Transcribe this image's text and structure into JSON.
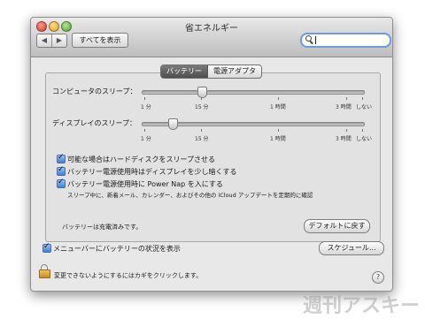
{
  "window": {
    "title": "省エネルギー"
  },
  "toolbar": {
    "back_label": "◀",
    "forward_label": "▶",
    "show_all_label": "すべてを表示",
    "search_placeholder": ""
  },
  "tabs": [
    {
      "label": "バッテリー",
      "active": true
    },
    {
      "label": "電源アダプタ",
      "active": false
    }
  ],
  "sliders": {
    "computer_sleep": {
      "label": "コンピュータのスリープ：",
      "value": "15 分",
      "ticks": [
        "1 分",
        "15 分",
        "1 時間",
        "3 時間",
        "しない"
      ]
    },
    "display_sleep": {
      "label": "ディスプレイのスリープ：",
      "value": "5 分",
      "ticks": [
        "1 分",
        "15 分",
        "1 時間",
        "3 時間",
        "しない"
      ]
    }
  },
  "checkboxes": [
    {
      "label": "可能な場合はハードディスクをスリープさせる",
      "checked": true
    },
    {
      "label": "バッテリー電源使用時はディスプレイを少し暗くする",
      "checked": true
    },
    {
      "label": "バッテリー電源使用時に Power Nap を入にする",
      "checked": true,
      "sublabel": "スリープ中に、新着メール、カレンダー、およびその他の iCloud アップデートを定期的に確認"
    }
  ],
  "status": {
    "battery_text": "バッテリーは充電済みです。"
  },
  "buttons": {
    "defaults": "デフォルトに戻す",
    "schedule": "スケジュール..."
  },
  "menubar_option": {
    "label": "メニューバーにバッテリーの状況を表示",
    "checked": true
  },
  "footer": {
    "lock_text": "変更できないようにするにはカギをクリックします。",
    "help_label": "?"
  },
  "watermark": {
    "text": "週刊アスキー"
  },
  "colors": {
    "accent": "#3d7fd6",
    "search_focus": "#6b9be0"
  }
}
